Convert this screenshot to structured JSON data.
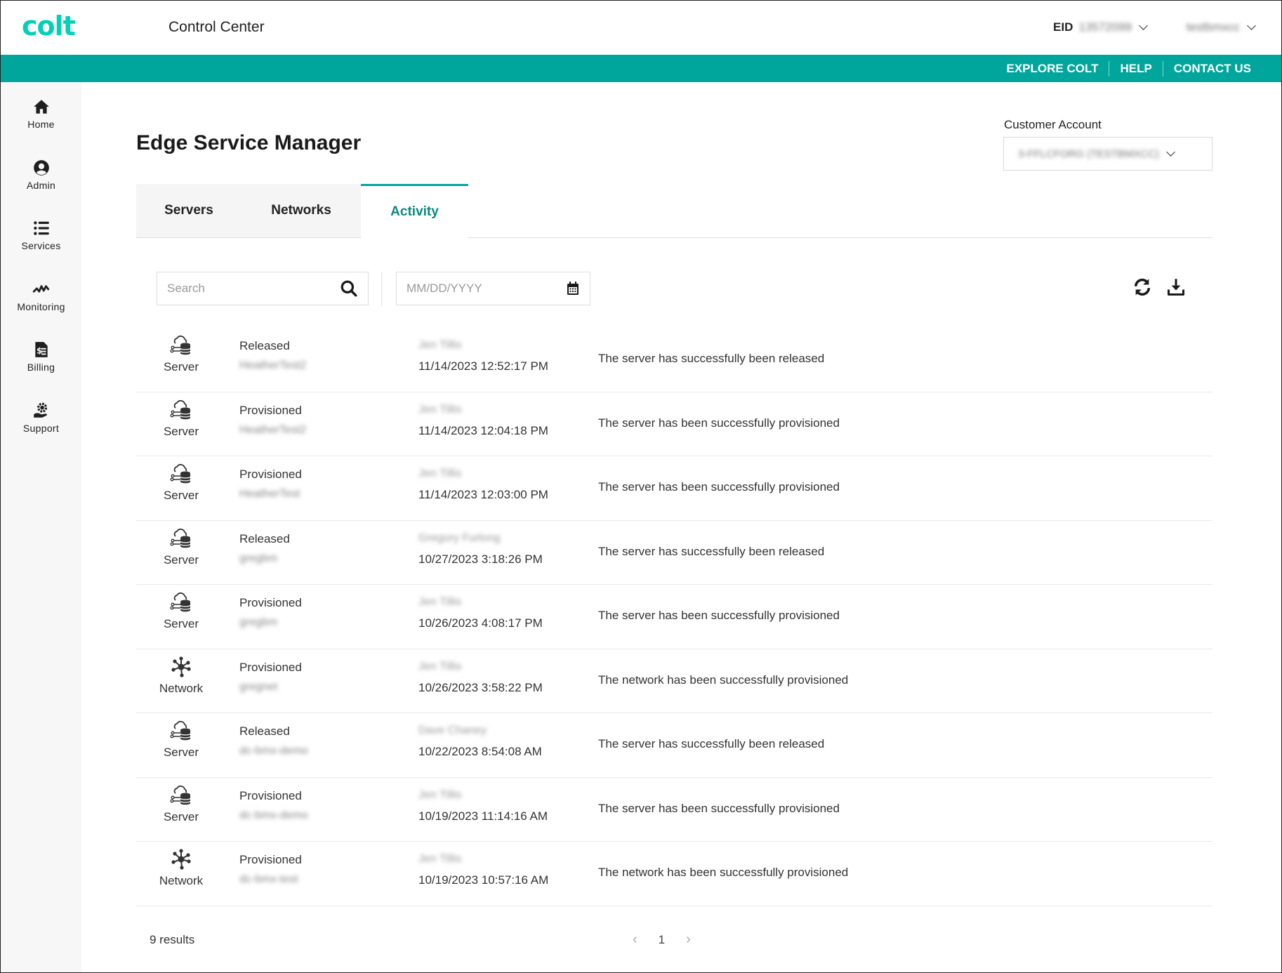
{
  "header": {
    "logo": "colt",
    "app_title": "Control Center",
    "eid_label": "EID",
    "eid_value": "13572099",
    "user_name": "testbmxcc"
  },
  "top_links": [
    "EXPLORE COLT",
    "HELP",
    "CONTACT US"
  ],
  "sidebar": {
    "items": [
      {
        "label": "Home",
        "icon": "home-icon"
      },
      {
        "label": "Admin",
        "icon": "user-circle-icon"
      },
      {
        "label": "Services",
        "icon": "list-icon"
      },
      {
        "label": "Monitoring",
        "icon": "pulse-icon"
      },
      {
        "label": "Billing",
        "icon": "invoice-icon"
      },
      {
        "label": "Support",
        "icon": "hand-gear-icon"
      }
    ]
  },
  "page": {
    "title": "Edge Service Manager",
    "customer_account_label": "Customer Account",
    "customer_account_value": "3-FFLCFORG (TESTBMXCC)"
  },
  "tabs": [
    {
      "label": "Servers",
      "active": false
    },
    {
      "label": "Networks",
      "active": false
    },
    {
      "label": "Activity",
      "active": true
    }
  ],
  "filters": {
    "search_placeholder": "Search",
    "date_placeholder": "MM/DD/YYYY"
  },
  "activity": [
    {
      "type": "Server",
      "status": "Released",
      "resource": "HeatherTest2",
      "user": "Jen Tillis",
      "date": "11/14/2023 12:52:17 PM",
      "message": "The server has successfully been released"
    },
    {
      "type": "Server",
      "status": "Provisioned",
      "resource": "HeatherTest2",
      "user": "Jen Tillis",
      "date": "11/14/2023 12:04:18 PM",
      "message": "The server has been successfully provisioned"
    },
    {
      "type": "Server",
      "status": "Provisioned",
      "resource": "HeatherTest",
      "user": "Jen Tillis",
      "date": "11/14/2023 12:03:00 PM",
      "message": "The server has been successfully provisioned"
    },
    {
      "type": "Server",
      "status": "Released",
      "resource": "gregbm",
      "user": "Gregory Furlong",
      "date": "10/27/2023 3:18:26 PM",
      "message": "The server has successfully been released"
    },
    {
      "type": "Server",
      "status": "Provisioned",
      "resource": "gregbm",
      "user": "Jen Tillis",
      "date": "10/26/2023 4:08:17 PM",
      "message": "The server has been successfully provisioned"
    },
    {
      "type": "Network",
      "status": "Provisioned",
      "resource": "gregnet",
      "user": "Jen Tillis",
      "date": "10/26/2023 3:58:22 PM",
      "message": "The network has been successfully provisioned"
    },
    {
      "type": "Server",
      "status": "Released",
      "resource": "dc-bmx-demo",
      "user": "Dave Chaney",
      "date": "10/22/2023 8:54:08 AM",
      "message": "The server has successfully been released"
    },
    {
      "type": "Server",
      "status": "Provisioned",
      "resource": "dc-bmx-demo",
      "user": "Jen Tillis",
      "date": "10/19/2023 11:14:16 AM",
      "message": "The server has been successfully provisioned"
    },
    {
      "type": "Network",
      "status": "Provisioned",
      "resource": "dc-bmx-test",
      "user": "Jen Tillis",
      "date": "10/19/2023 10:57:16 AM",
      "message": "The network has been successfully provisioned"
    }
  ],
  "footer": {
    "results": "9 results",
    "current_page": "1",
    "prev": "‹",
    "next": "›"
  },
  "colors": {
    "brand_teal": "#00a69c",
    "logo": "#00d1b8",
    "active_tab_text": "#0b8a80"
  }
}
